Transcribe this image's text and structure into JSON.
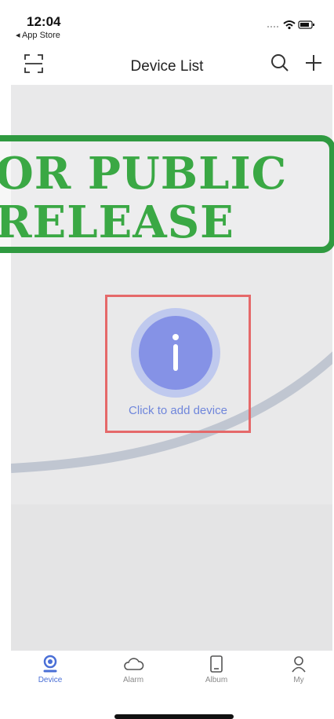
{
  "status_bar": {
    "time": "12:04",
    "back_app": "◂ App Store"
  },
  "nav": {
    "title": "Device List",
    "icons": [
      "scan-icon",
      "search-icon",
      "plus-icon"
    ]
  },
  "overlay_stamp": {
    "line1": "OR PUBLIC",
    "line2": "RELEASE",
    "color": "#3aa844"
  },
  "empty_state": {
    "label": "Click to add device",
    "accent": "#8592e6"
  },
  "tabs": [
    {
      "label": "Device",
      "icon": "device-pin-icon",
      "active": true
    },
    {
      "label": "Alarm",
      "icon": "cloud-icon",
      "active": false
    },
    {
      "label": "Album",
      "icon": "tablet-icon",
      "active": false
    },
    {
      "label": "My",
      "icon": "person-icon",
      "active": false
    }
  ],
  "colors": {
    "accent": "#4a6fd6",
    "content_bg": "#e9e9ea",
    "highlight_box": "#e5696a"
  }
}
